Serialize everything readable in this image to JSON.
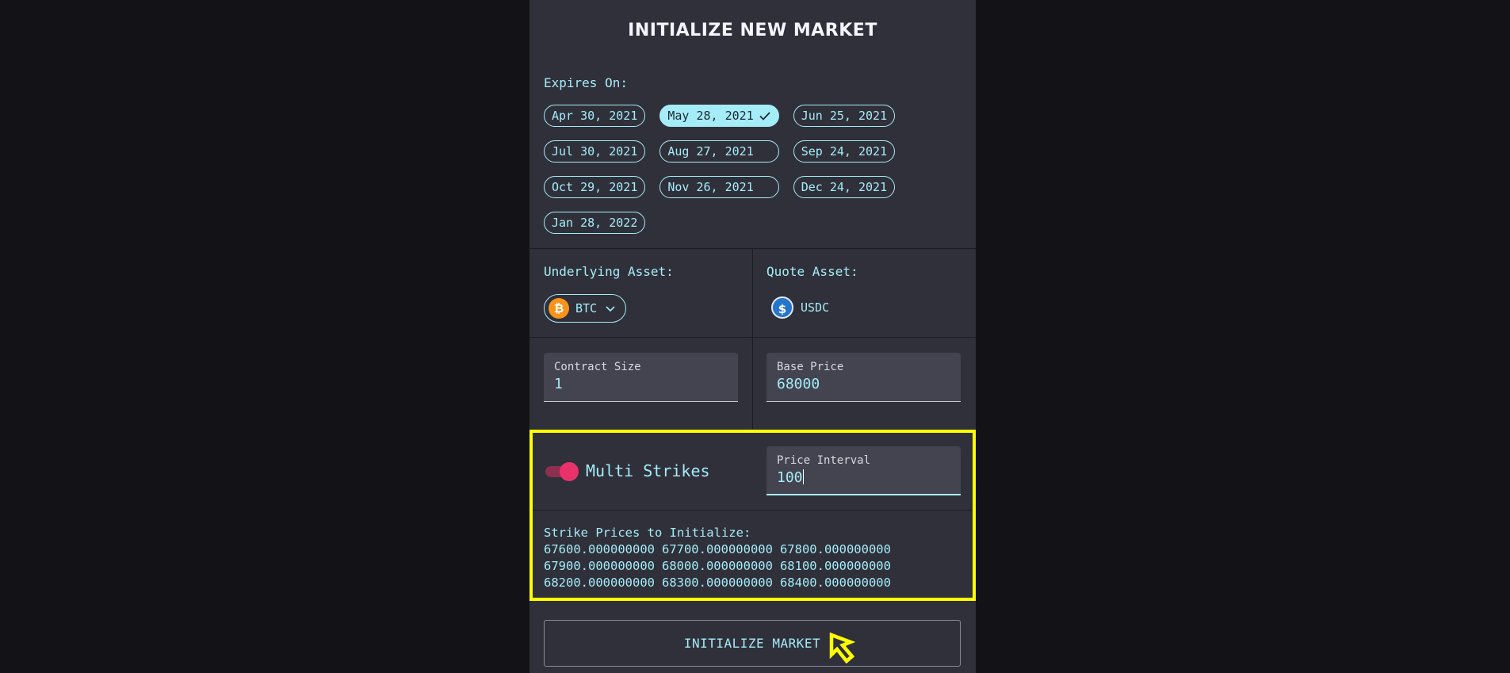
{
  "title": "INITIALIZE NEW MARKET",
  "expires": {
    "label": "Expires On:",
    "options": [
      {
        "label": "Apr 30, 2021",
        "selected": false
      },
      {
        "label": "May 28, 2021",
        "selected": true
      },
      {
        "label": "Jun 25, 2021",
        "selected": false
      },
      {
        "label": "Jul 30, 2021",
        "selected": false
      },
      {
        "label": "Aug 27, 2021",
        "selected": false
      },
      {
        "label": "Sep 24, 2021",
        "selected": false
      },
      {
        "label": "Oct 29, 2021",
        "selected": false
      },
      {
        "label": "Nov 26, 2021",
        "selected": false
      },
      {
        "label": "Dec 24, 2021",
        "selected": false
      },
      {
        "label": "Jan 28, 2022",
        "selected": false
      }
    ]
  },
  "underlying": {
    "label": "Underlying Asset:",
    "value": "BTC",
    "icon": "bitcoin-icon",
    "icon_glyph": "₿"
  },
  "quote": {
    "label": "Quote Asset:",
    "value": "USDC",
    "icon": "usdc-icon",
    "icon_glyph": "$"
  },
  "contract_size": {
    "label": "Contract Size",
    "value": "1"
  },
  "base_price": {
    "label": "Base Price",
    "value": "68000"
  },
  "multi_strikes": {
    "label": "Multi Strikes",
    "enabled": true
  },
  "price_interval": {
    "label": "Price Interval",
    "value": "100"
  },
  "strikes": {
    "label": "Strike Prices to Initialize:",
    "values": [
      "67600.000000000",
      "67700.000000000",
      "67800.000000000",
      "67900.000000000",
      "68000.000000000",
      "68100.000000000",
      "68200.000000000",
      "68300.000000000",
      "68400.000000000"
    ]
  },
  "button": {
    "label": "INITIALIZE MARKET"
  },
  "colors": {
    "accent": "#a4ecf8",
    "panel": "#30303a",
    "toggle": "#e9316b",
    "highlight": "#ffff00"
  }
}
